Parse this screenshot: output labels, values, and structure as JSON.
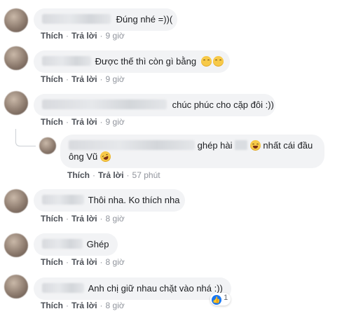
{
  "actions": {
    "like": "Thích",
    "reply": "Trả lời"
  },
  "comments": [
    {
      "text": "Đúng nhé =))(",
      "time": "9 giờ"
    },
    {
      "text": "Được thế thì còn gì bằng",
      "time": "9 giờ"
    },
    {
      "text": "chúc phúc cho cặp đôi :))",
      "time": "9 giờ"
    },
    {
      "text_a": "ghép hài",
      "text_b": "nhất cái đầu",
      "text_c": "ông Vũ",
      "time": "57 phút"
    },
    {
      "text": "Thôi nha. Ko thích nha",
      "time": "8 giờ"
    },
    {
      "text": "Ghép",
      "time": "8 giờ"
    },
    {
      "text": "Anh chị giữ nhau chặt vào nhá :))",
      "time": "8 giờ",
      "reactions": "1"
    }
  ],
  "icons": {
    "emoji": "grinning-face-icon",
    "laugh": "tears-of-joy-icon",
    "like": "like-reaction-icon"
  }
}
